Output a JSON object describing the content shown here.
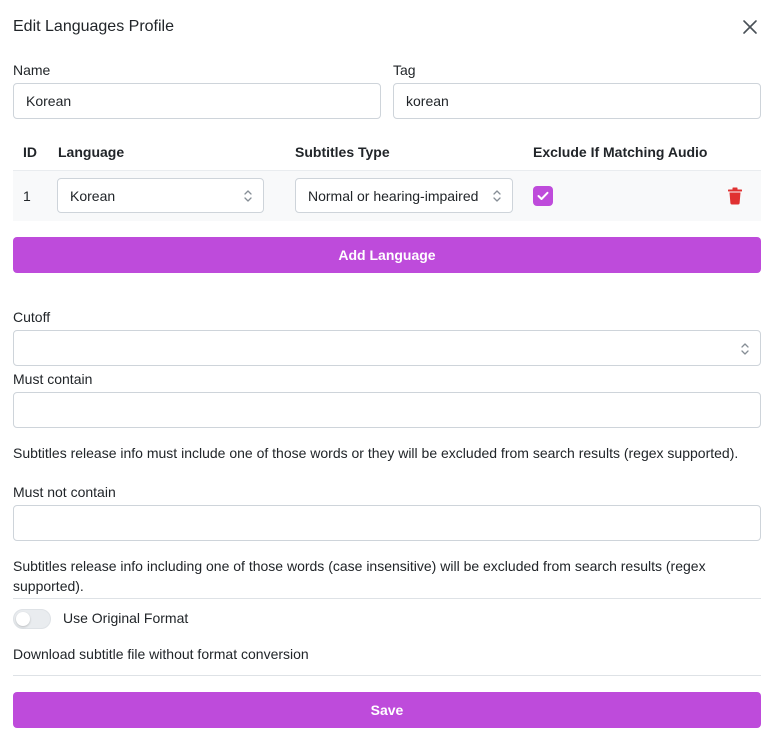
{
  "modal": {
    "title": "Edit Languages Profile"
  },
  "name_field": {
    "label": "Name",
    "value": "Korean"
  },
  "tag_field": {
    "label": "Tag",
    "value": "korean"
  },
  "table": {
    "headers": [
      "ID",
      "Language",
      "Subtitles Type",
      "Exclude If Matching Audio"
    ],
    "rows": [
      {
        "id": "1",
        "language": "Korean",
        "subtitles_type": "Normal or hearing-impaired",
        "exclude_matching_audio": true
      }
    ]
  },
  "add_language_label": "Add Language",
  "cutoff": {
    "label": "Cutoff",
    "value": ""
  },
  "must_contain": {
    "label": "Must contain",
    "value": "",
    "help": "Subtitles release info must include one of those words or they will be excluded from search results (regex supported)."
  },
  "must_not_contain": {
    "label": "Must not contain",
    "value": "",
    "help_line1": "Subtitles release info including one of those words (case insensitive) will be excluded from search results (regex",
    "help_line2": "supported)."
  },
  "original_format": {
    "label": "Use Original Format",
    "enabled": false,
    "help": "Download subtitle file without format conversion"
  },
  "save_label": "Save",
  "colors": {
    "accent": "#be4bdb",
    "danger": "#e03131",
    "row_bg": "#f8f9fa",
    "border": "#ced4da"
  }
}
